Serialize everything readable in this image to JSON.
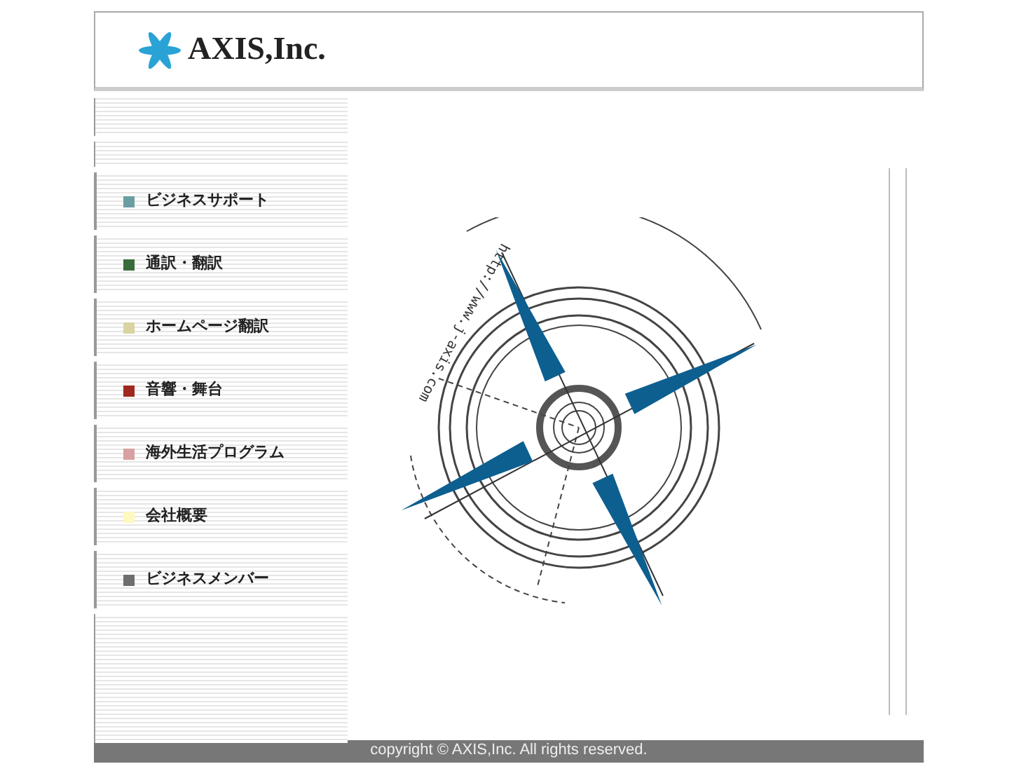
{
  "header": {
    "logo_text": "AXIS,Inc."
  },
  "sidebar": {
    "items": [
      {
        "label": "ビジネスサポート",
        "color": "#6b9ea3"
      },
      {
        "label": "通訳・翻訳",
        "color": "#3a6b3a"
      },
      {
        "label": "ホームページ翻訳",
        "color": "#d8d4a0"
      },
      {
        "label": "音響・舞台",
        "color": "#a0281f"
      },
      {
        "label": "海外生活プログラム",
        "color": "#d8a0a0"
      },
      {
        "label": "会社概要",
        "color": "#fff8c0"
      },
      {
        "label": "ビジネスメンバー",
        "color": "#6e6e6e"
      }
    ]
  },
  "main": {
    "url_text": "http://www.j-axis.com"
  },
  "footer": {
    "copyright": "copyright © AXIS,Inc. All rights reserved."
  }
}
